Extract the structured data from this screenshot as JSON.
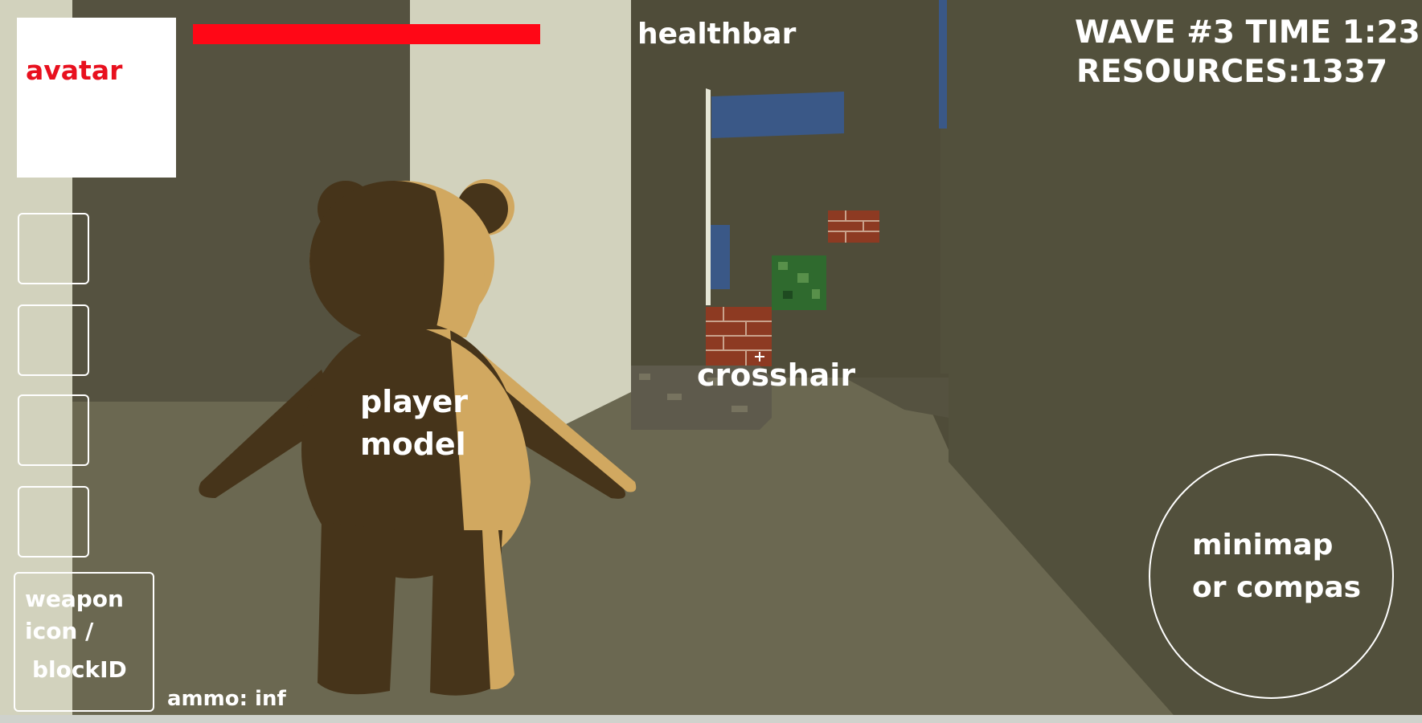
{
  "hud": {
    "avatar_label": "avatar",
    "healthbar_label": "healthbar",
    "health_fraction": 0.8,
    "wave_line": "WAVE #3 TIME 1:23",
    "resources_line": "RESOURCES:1337",
    "inventory_slots": 4,
    "weapon_lines": [
      "weapon",
      "icon /",
      "blockID"
    ],
    "ammo_label": "ammo: inf",
    "player_model_lines": [
      "player",
      "model"
    ],
    "crosshair_label": "crosshair",
    "minimap_lines": [
      "minimap",
      "or compas"
    ]
  },
  "colors": {
    "health": "#ff0716",
    "avatar_text": "#e8101e",
    "hud_text": "#ffffff",
    "wall_dark": "#4f4c39",
    "floor": "#6b6851",
    "light_wall": "#d2d2bd",
    "bear_dark": "#46341a",
    "bear_light": "#d1a860",
    "banner_blue": "#3a5887"
  },
  "icons": {
    "crosshair": "crosshair-icon",
    "player": "teddy-bear-player-model",
    "blocks": [
      "brick-block",
      "leaf-block",
      "stone-block"
    ]
  }
}
